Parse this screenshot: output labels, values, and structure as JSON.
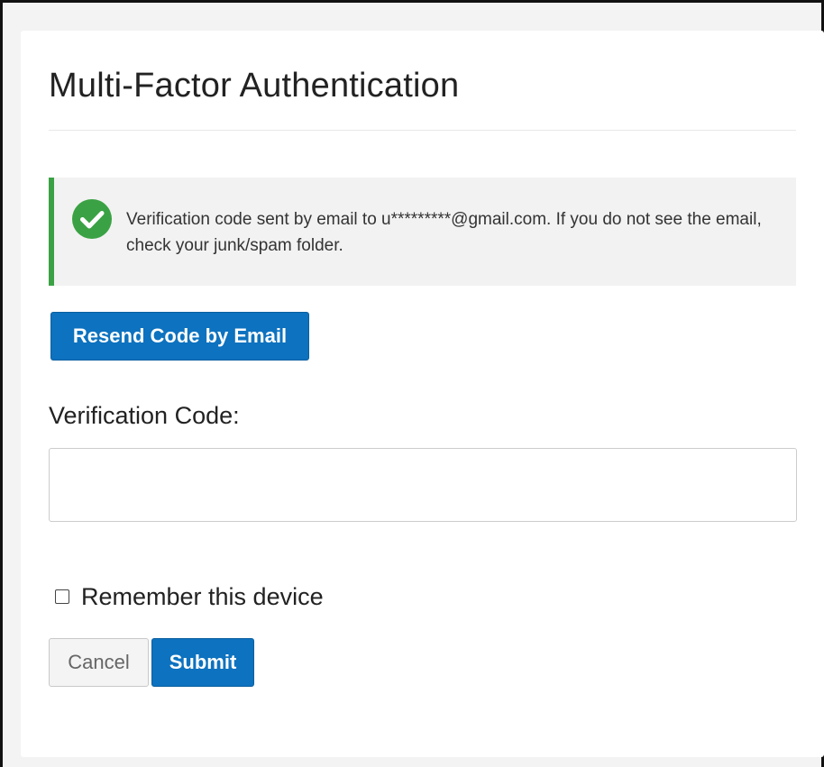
{
  "page": {
    "title": "Multi-Factor Authentication"
  },
  "alert": {
    "status": "success",
    "icon": "check-circle-icon",
    "message": "Verification code sent by email to u*********@gmail.com. If you do not see the email, check your junk/spam folder.",
    "accent_color": "#3aa244"
  },
  "buttons": {
    "resend_label": "Resend Code by Email",
    "cancel_label": "Cancel",
    "submit_label": "Submit",
    "primary_color": "#0d72bf"
  },
  "form": {
    "code_label": "Verification Code:",
    "code_value": "",
    "remember_label": "Remember this device",
    "remember_checked": false
  }
}
